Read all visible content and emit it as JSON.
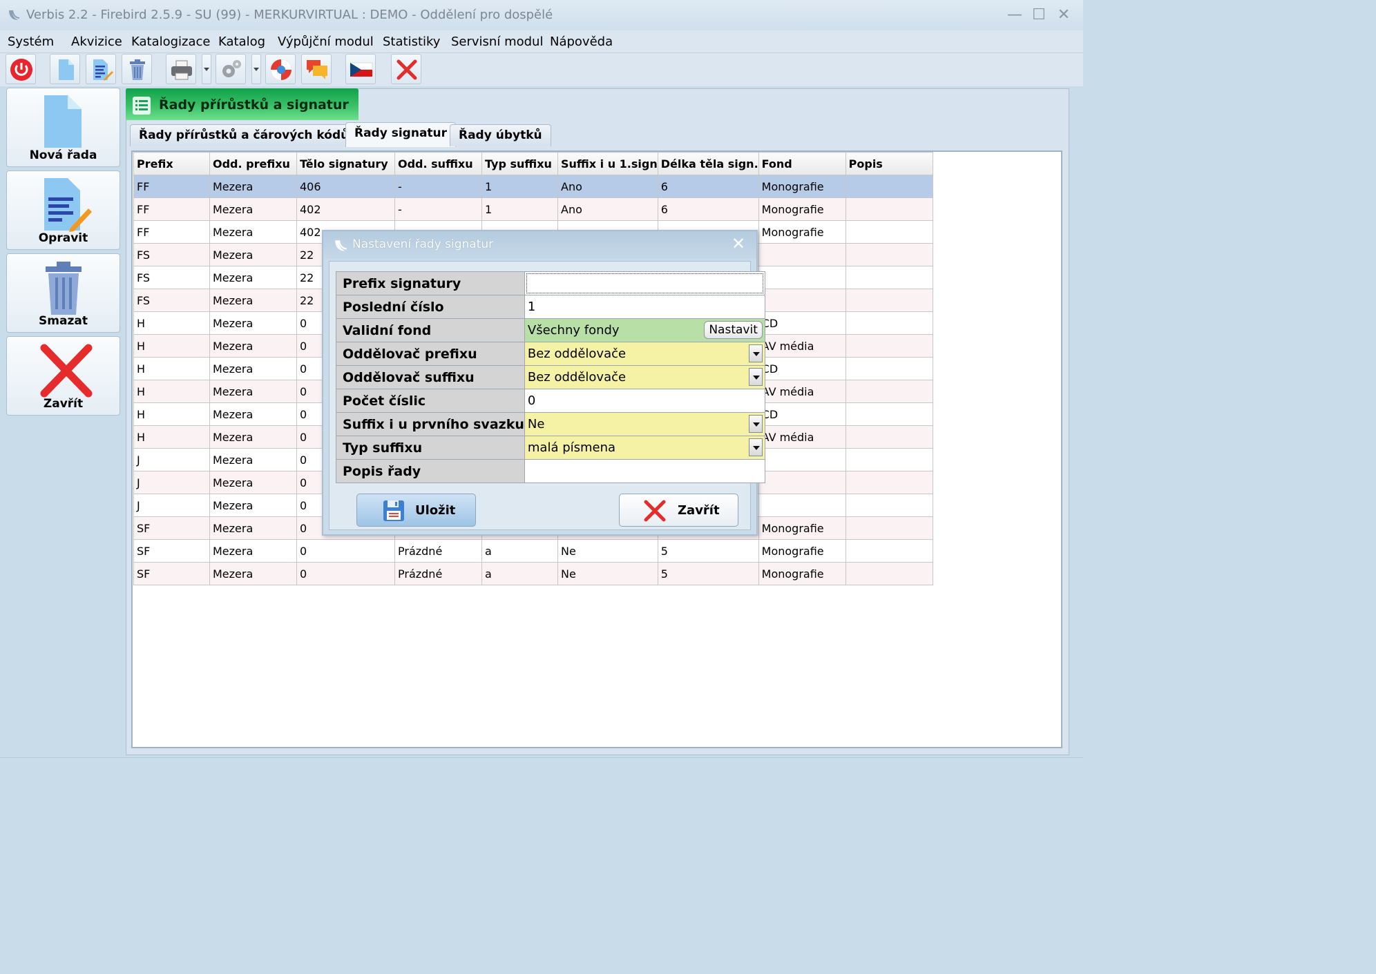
{
  "window": {
    "title": "Verbis 2.2 - Firebird 2.5.9 - SU (99) - MERKURVIRTUAL : DEMO - Oddělení pro dospělé",
    "minimize": "—",
    "maximize": "☐",
    "close": "✕"
  },
  "menu": [
    "Systém",
    "Akvizice",
    "Katalogizace",
    "Katalog",
    "Výpůjční modul",
    "Statistiky",
    "Servisní modul",
    "Nápověda"
  ],
  "toolbar": {
    "icons": [
      "power-icon",
      "new-document-icon",
      "edit-document-icon",
      "trash-icon",
      "printer-icon",
      "gear-icon",
      "lifebuoy-icon",
      "chat-icon",
      "czech-flag-icon",
      "close-icon"
    ]
  },
  "side_actions": {
    "new": "Nová řada",
    "edit": "Opravit",
    "delete": "Smazat",
    "close": "Zavřít"
  },
  "panel": {
    "title": "Řady přírůstků a signatur"
  },
  "tabs": [
    "Řady přírůstků a čárových kódů",
    "Řady signatur",
    "Řady úbytků"
  ],
  "table": {
    "columns": [
      "Prefix",
      "Odd. prefixu",
      "Tělo signatury",
      "Odd. suffixu",
      "Typ suffixu",
      "Suffix i u 1.sign",
      "Délka těla sign.",
      "Fond",
      "Popis"
    ],
    "rows": [
      [
        "FF",
        "Mezera",
        "406",
        "-",
        "1",
        "Ano",
        "6",
        "Monografie",
        ""
      ],
      [
        "FF",
        "Mezera",
        "402",
        "-",
        "1",
        "Ano",
        "6",
        "Monografie",
        ""
      ],
      [
        "FF",
        "Mezera",
        "402",
        "",
        "",
        "",
        "",
        "Monografie",
        ""
      ],
      [
        "FS",
        "Mezera",
        "22",
        "",
        "",
        "",
        "",
        "",
        ""
      ],
      [
        "FS",
        "Mezera",
        "22",
        "",
        "",
        "",
        "",
        "",
        ""
      ],
      [
        "FS",
        "Mezera",
        "22",
        "",
        "",
        "",
        "",
        "",
        ""
      ],
      [
        "H",
        "Mezera",
        "0",
        "",
        "",
        "",
        "",
        "CD",
        ""
      ],
      [
        "H",
        "Mezera",
        "0",
        "",
        "",
        "",
        "",
        "AV média",
        ""
      ],
      [
        "H",
        "Mezera",
        "0",
        "",
        "",
        "",
        "",
        "CD",
        ""
      ],
      [
        "H",
        "Mezera",
        "0",
        "",
        "",
        "",
        "",
        "AV média",
        ""
      ],
      [
        "H",
        "Mezera",
        "0",
        "",
        "",
        "",
        "",
        "CD",
        ""
      ],
      [
        "H",
        "Mezera",
        "0",
        "",
        "",
        "",
        "",
        "AV média",
        ""
      ],
      [
        "J",
        "Mezera",
        "0",
        "",
        "",
        "",
        "",
        "",
        ""
      ],
      [
        "J",
        "Mezera",
        "0",
        "",
        "",
        "",
        "",
        "",
        ""
      ],
      [
        "J",
        "Mezera",
        "0",
        "",
        "",
        "",
        "",
        "",
        ""
      ],
      [
        "SF",
        "Mezera",
        "0",
        "",
        "",
        "",
        "",
        "Monografie",
        ""
      ],
      [
        "SF",
        "Mezera",
        "0",
        "Prázdné",
        "a",
        "Ne",
        "5",
        "Monografie",
        ""
      ],
      [
        "SF",
        "Mezera",
        "0",
        "Prázdné",
        "a",
        "Ne",
        "5",
        "Monografie",
        ""
      ]
    ]
  },
  "dialog": {
    "title": "Nastavení řady signatur",
    "close": "✕",
    "fields": {
      "prefix": {
        "label": "Prefix signatury",
        "value": ""
      },
      "last_number": {
        "label": "Poslední číslo",
        "value": "1"
      },
      "fund": {
        "label": "Validní fond",
        "value": "Všechny fondy",
        "button": "Nastavit"
      },
      "prefix_sep": {
        "label": "Oddělovač prefixu",
        "value": "Bez oddělovače"
      },
      "suffix_sep": {
        "label": "Oddělovač suffixu",
        "value": "Bez oddělovače"
      },
      "digits": {
        "label": "Počet číslic",
        "value": "0"
      },
      "suffix_first": {
        "label": "Suffix i u prvního svazku",
        "value": "Ne"
      },
      "suffix_type": {
        "label": "Typ suffixu",
        "value": "malá písmena"
      },
      "description": {
        "label": "Popis řady",
        "value": ""
      }
    },
    "save": "Uložit",
    "close_button": "Zavřít"
  },
  "colors": {
    "accent_green": "#1fae55",
    "selected_row": "#b5cbe8",
    "combo_yellow": "#f6f2a5",
    "fund_green": "#b8dfa5"
  }
}
